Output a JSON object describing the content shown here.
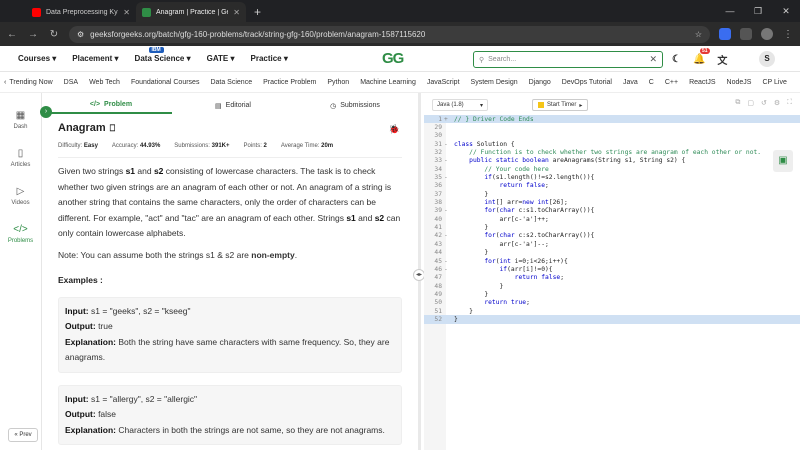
{
  "browser": {
    "tabs": [
      {
        "title": "Data Preprocessing Kya Hai? | T",
        "color": "#ff0000"
      },
      {
        "title": "Anagram | Practice | GeeksforG",
        "color": "#2f8d46"
      }
    ],
    "url": "geeksforgeeks.org/batch/gfg-160-problems/track/string-gfg-160/problem/anagram-1587115620"
  },
  "nav": {
    "items": [
      "Courses",
      "Placement",
      "Data Science",
      "GATE",
      "Practice"
    ],
    "ibm_badge": "IBM",
    "logo": "GG",
    "search_placeholder": "Search...",
    "notification_count": "51",
    "avatar": "S"
  },
  "trending": [
    "Trending Now",
    "DSA",
    "Web Tech",
    "Foundational Courses",
    "Data Science",
    "Practice Problem",
    "Python",
    "Machine Learning",
    "JavaScript",
    "System Design",
    "Django",
    "DevOps Tutorial",
    "Java",
    "C",
    "C++",
    "ReactJS",
    "NodeJS",
    "CP Live"
  ],
  "sidebar": {
    "items": [
      {
        "label": "Dash",
        "icon": "dash-icon"
      },
      {
        "label": "Articles",
        "icon": "articles-icon"
      },
      {
        "label": "Videos",
        "icon": "videos-icon"
      },
      {
        "label": "Problems",
        "icon": "problems-icon"
      }
    ],
    "prev": "Prev"
  },
  "problem_tabs": [
    "Problem",
    "Editorial",
    "Submissions"
  ],
  "problem": {
    "title": "Anagram",
    "meta": {
      "difficulty_label": "Difficulty:",
      "difficulty": "Easy",
      "accuracy_label": "Accuracy:",
      "accuracy": "44.93%",
      "submissions_label": "Submissions:",
      "submissions": "391K+",
      "points_label": "Points:",
      "points": "2",
      "time_label": "Average Time:",
      "time": "20m"
    },
    "desc": {
      "p1": "Given two strings ",
      "s1": "s1",
      "p2": " and ",
      "s2": "s2",
      "p3": " consisting of lowercase characters. The task is to check whether two given strings are an anagram of each other or not. An anagram of a string is another string that contains the same characters, only the order of characters can be different. For example, \"act\" and \"tac\" are an anagram of each other. Strings ",
      "s1b": "s1",
      "p4": " and ",
      "s2b": "s2",
      "p5": " can only contain lowercase alphabets."
    },
    "note_text": "Note: You can assume both the strings s1 & s2 are ",
    "note_bold": "non-empty",
    "note_end": ".",
    "examples_heading": "Examples :",
    "examples": [
      {
        "input": "s1 = \"geeks\", s2 = \"kseeg\"",
        "output": "true",
        "explanation": "Both the string have same characters with same frequency. So, they are anagrams."
      },
      {
        "input": "s1 = \"allergy\", s2 = \"allergic\"",
        "output": "false",
        "explanation": "Characters in both the strings are not same, so they are not anagrams."
      }
    ],
    "labels": {
      "input": "Input:",
      "output": "Output:",
      "explanation": "Explanation:"
    }
  },
  "editor": {
    "language": "Java (1.8)",
    "timer": "Start Timer",
    "lines": [
      {
        "n": "1",
        "fold": "+",
        "text": "// } Driver Code Ends",
        "cls": "cm",
        "hl": true
      },
      {
        "n": "29",
        "fold": "",
        "text": "",
        "cls": "",
        "hl": false
      },
      {
        "n": "30",
        "fold": "",
        "text": "",
        "cls": "",
        "hl": false
      },
      {
        "n": "31",
        "fold": "-",
        "text": "class Solution {",
        "cls": "",
        "hl": false
      },
      {
        "n": "32",
        "fold": "",
        "text": "    // Function is to check whether two strings are anagram of each other or not.",
        "cls": "cm",
        "hl": false
      },
      {
        "n": "33",
        "fold": "-",
        "text": "    public static boolean areAnagrams(String s1, String s2) {",
        "cls": "",
        "hl": false
      },
      {
        "n": "34",
        "fold": "",
        "text": "        // Your code here",
        "cls": "cm",
        "hl": false
      },
      {
        "n": "35",
        "fold": "-",
        "text": "        if(s1.length()!=s2.length()){",
        "cls": "",
        "hl": false
      },
      {
        "n": "36",
        "fold": "",
        "text": "            return false;",
        "cls": "",
        "hl": false
      },
      {
        "n": "37",
        "fold": "",
        "text": "        }",
        "cls": "",
        "hl": false
      },
      {
        "n": "38",
        "fold": "",
        "text": "        int[] arr=new int[26];",
        "cls": "",
        "hl": false
      },
      {
        "n": "39",
        "fold": "-",
        "text": "        for(char c:s1.toCharArray()){",
        "cls": "",
        "hl": false
      },
      {
        "n": "40",
        "fold": "",
        "text": "            arr[c-'a']++;",
        "cls": "",
        "hl": false
      },
      {
        "n": "41",
        "fold": "",
        "text": "        }",
        "cls": "",
        "hl": false
      },
      {
        "n": "42",
        "fold": "-",
        "text": "        for(char c:s2.toCharArray()){",
        "cls": "",
        "hl": false
      },
      {
        "n": "43",
        "fold": "",
        "text": "            arr[c-'a']--;",
        "cls": "",
        "hl": false
      },
      {
        "n": "44",
        "fold": "",
        "text": "        }",
        "cls": "",
        "hl": false
      },
      {
        "n": "45",
        "fold": "-",
        "text": "        for(int i=0;i<26;i++){",
        "cls": "",
        "hl": false
      },
      {
        "n": "46",
        "fold": "-",
        "text": "            if(arr[i]!=0){",
        "cls": "",
        "hl": false
      },
      {
        "n": "47",
        "fold": "",
        "text": "                return false;",
        "cls": "",
        "hl": false
      },
      {
        "n": "48",
        "fold": "",
        "text": "            }",
        "cls": "",
        "hl": false
      },
      {
        "n": "49",
        "fold": "",
        "text": "        }",
        "cls": "",
        "hl": false
      },
      {
        "n": "50",
        "fold": "",
        "text": "        return true;",
        "cls": "",
        "hl": false
      },
      {
        "n": "51",
        "fold": "",
        "text": "    }",
        "cls": "",
        "hl": false
      },
      {
        "n": "52",
        "fold": "",
        "text": "}",
        "cls": "",
        "hl": true
      }
    ]
  }
}
